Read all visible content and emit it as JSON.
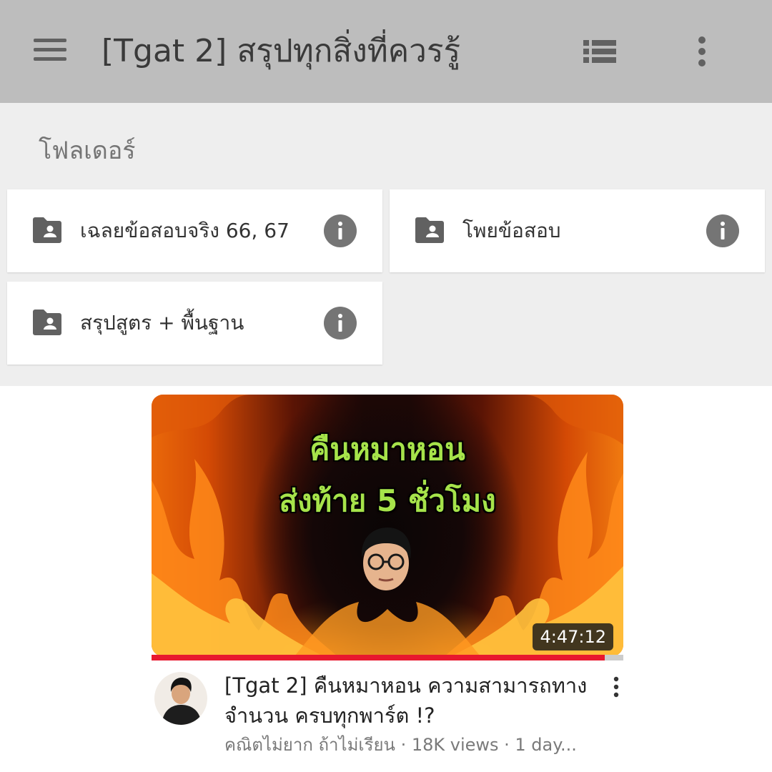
{
  "app_bar": {
    "title": "[Tgat 2] สรุปทุกสิ่งที่ควรรู้",
    "menu_icon": "hamburger-menu-icon",
    "list_view_icon": "list-view-icon",
    "more_icon": "more-vert-icon",
    "background": "#bdbdbd"
  },
  "folders": {
    "heading": "โฟลเดอร์",
    "items": [
      {
        "name": "เฉลยข้อสอบจริง 66, 67",
        "icon": "shared-folder-icon",
        "info_icon": "info-icon"
      },
      {
        "name": "โพยข้อสอบ",
        "icon": "shared-folder-icon",
        "info_icon": "info-icon"
      },
      {
        "name": "สรุปสูตร + พื้นฐาน",
        "icon": "shared-folder-icon",
        "info_icon": "info-icon"
      }
    ]
  },
  "video": {
    "thumbnail_text": [
      "คืนหมาหอน",
      "ส่งท้าย 5 ชั่วโมง"
    ],
    "duration": "4:47:12",
    "watched_fraction": 0.96,
    "title": "[Tgat 2] คืนหมาหอน ความสามารถทางจำนวน ครบทุกพาร์ต !?",
    "meta": "คณิตไม่ยาก ถ้าไม่เรียน · 18K views · 1 day...",
    "more_icon": "more-vert-icon",
    "accent": "#e8182e"
  }
}
